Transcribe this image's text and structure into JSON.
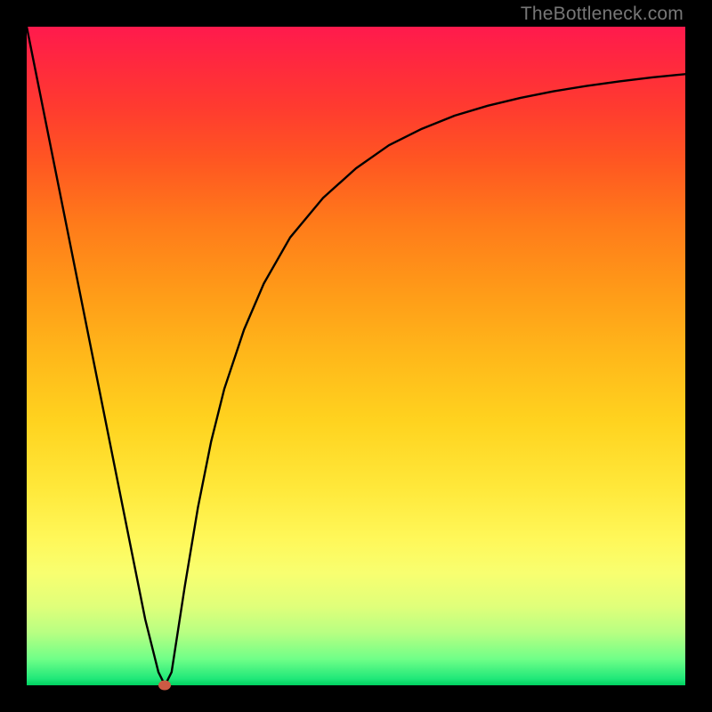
{
  "watermark": "TheBottleneck.com",
  "chart_data": {
    "type": "line",
    "title": "",
    "xlabel": "",
    "ylabel": "",
    "xlim": [
      0,
      100
    ],
    "ylim": [
      0,
      100
    ],
    "grid": false,
    "legend": false,
    "series": [
      {
        "name": "curve",
        "x": [
          0,
          2,
          4,
          6,
          8,
          10,
          12,
          14,
          16,
          18,
          20,
          21,
          22,
          24,
          26,
          28,
          30,
          33,
          36,
          40,
          45,
          50,
          55,
          60,
          65,
          70,
          75,
          80,
          85,
          90,
          95,
          100
        ],
        "y": [
          100,
          90,
          80,
          70,
          60,
          50,
          40,
          30,
          20,
          10,
          2,
          0,
          2,
          15,
          27,
          37,
          45,
          54,
          61,
          68,
          74,
          78.5,
          82,
          84.5,
          86.5,
          88,
          89.2,
          90.2,
          91,
          91.7,
          92.3,
          92.8
        ]
      }
    ],
    "marker": {
      "x": 21,
      "y": 0
    },
    "background_gradient": {
      "top_color": "#ff1a4d",
      "bottom_color": "#00d060"
    }
  }
}
